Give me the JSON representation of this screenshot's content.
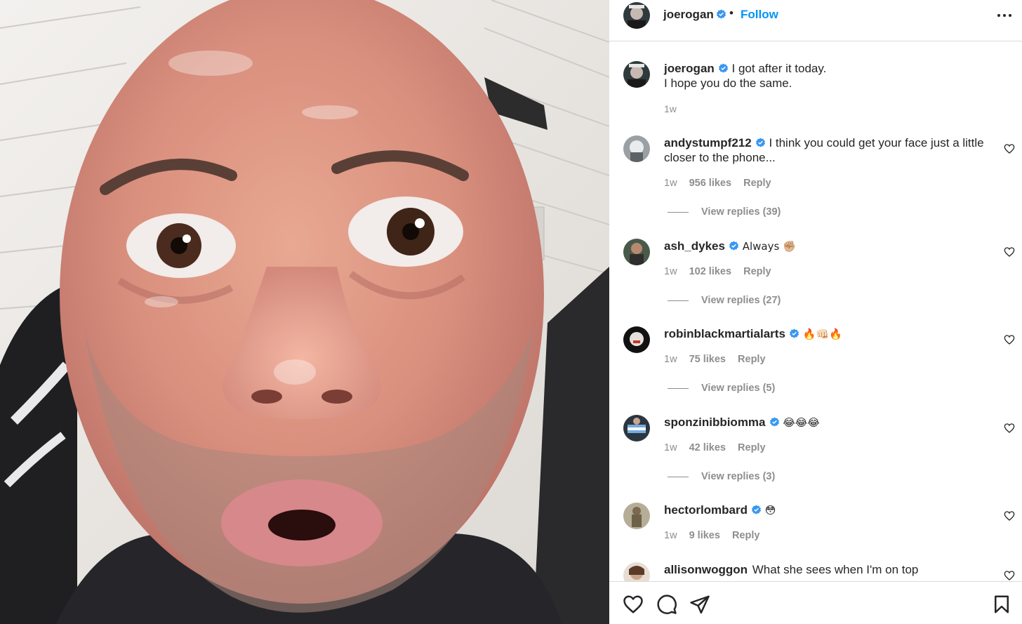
{
  "post": {
    "author": "joerogan",
    "follow_label": "Follow",
    "separator": "•"
  },
  "caption": {
    "username": "joerogan",
    "text_line1": "I got after it today.",
    "text_line2": "I hope you do the same.",
    "time": "1w"
  },
  "comments": [
    {
      "username": "andystumpf212",
      "verified": true,
      "text": "I think you could get your face just a little closer to the phone...",
      "time": "1w",
      "likes": "956 likes",
      "reply_label": "Reply",
      "view_replies": "View replies (39)"
    },
    {
      "username": "ash_dykes",
      "verified": true,
      "text": "Always ✊🏼",
      "time": "1w",
      "likes": "102 likes",
      "reply_label": "Reply",
      "view_replies": "View replies (27)"
    },
    {
      "username": "robinblackmartialarts",
      "verified": true,
      "text": "🔥👊🏻🔥",
      "time": "1w",
      "likes": "75 likes",
      "reply_label": "Reply",
      "view_replies": "View replies (5)"
    },
    {
      "username": "sponzinibbiomma",
      "verified": true,
      "text": "😂😂😂",
      "time": "1w",
      "likes": "42 likes",
      "reply_label": "Reply",
      "view_replies": "View replies (3)"
    },
    {
      "username": "hectorlombard",
      "verified": true,
      "text": "😳",
      "time": "1w",
      "likes": "9 likes",
      "reply_label": "Reply",
      "view_replies": ""
    },
    {
      "username": "allisonwoggon",
      "verified": false,
      "text": "What she sees when I'm on top",
      "time": "",
      "likes": "",
      "reply_label": "",
      "view_replies": ""
    }
  ],
  "icons": {
    "verified": "verified-badge-icon",
    "more": "more-options-icon",
    "like": "heart-icon",
    "comment": "comment-bubble-icon",
    "share": "paper-plane-icon",
    "save": "bookmark-icon"
  },
  "colors": {
    "follow": "#0095f6",
    "verified": "#3897f0",
    "text": "#262626",
    "muted": "#8e8e8e",
    "border": "#dbdbdb"
  }
}
